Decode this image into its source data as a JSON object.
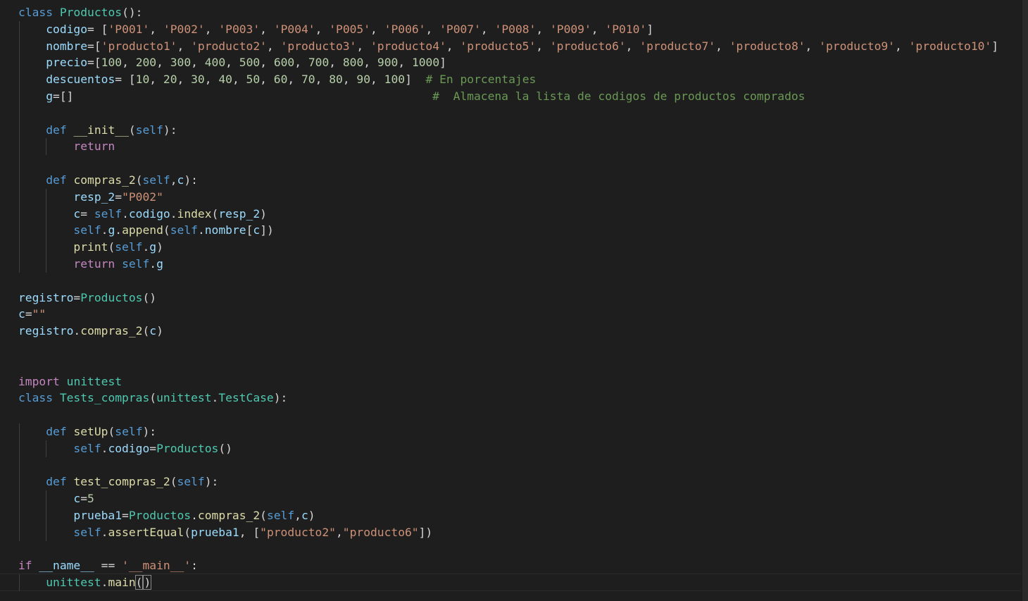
{
  "editor": {
    "language": "python",
    "theme": "dark",
    "colors": {
      "background": "#1e1e1e",
      "keyword": "#569cd6",
      "control": "#c586c0",
      "class": "#4ec9b0",
      "function": "#dcdcaa",
      "variable": "#9cdcfe",
      "string": "#ce9178",
      "number": "#b5cea8",
      "comment": "#6a9955",
      "text": "#d4d4d4"
    },
    "lines": [
      "class Productos():",
      "    codigo= ['P001', 'P002', 'P003', 'P004', 'P005', 'P006', 'P007', 'P008', 'P009', 'P010']",
      "    nombre=['producto1', 'producto2', 'producto3', 'producto4', 'producto5', 'producto6', 'producto7', 'producto8', 'producto9', 'producto10']",
      "    precio=[100, 200, 300, 400, 500, 600, 700, 800, 900, 1000]",
      "    descuentos= [10, 20, 30, 40, 50, 60, 70, 80, 90, 100]  # En porcentajes",
      "    g=[]                                                    #  Almacena la lista de codigos de productos comprados",
      "",
      "    def __init__(self):",
      "        return",
      "",
      "    def compras_2(self,c):",
      "        resp_2=\"P002\"",
      "        c= self.codigo.index(resp_2)",
      "        self.g.append(self.nombre[c])",
      "        print(self.g)",
      "        return self.g",
      "",
      "registro=Productos()",
      "c=\"\"",
      "registro.compras_2(c)",
      "",
      "",
      "import unittest",
      "class Tests_compras(unittest.TestCase):",
      "",
      "    def setUp(self):",
      "        self.codigo=Productos()",
      "",
      "    def test_compras_2(self):",
      "        c=5",
      "        prueba1=Productos.compras_2(self,c)",
      "        self.assertEqual(prueba1, [\"producto2\",\"producto6\"])",
      "",
      "if __name__ == '__main__':",
      "    unittest.main()"
    ]
  }
}
